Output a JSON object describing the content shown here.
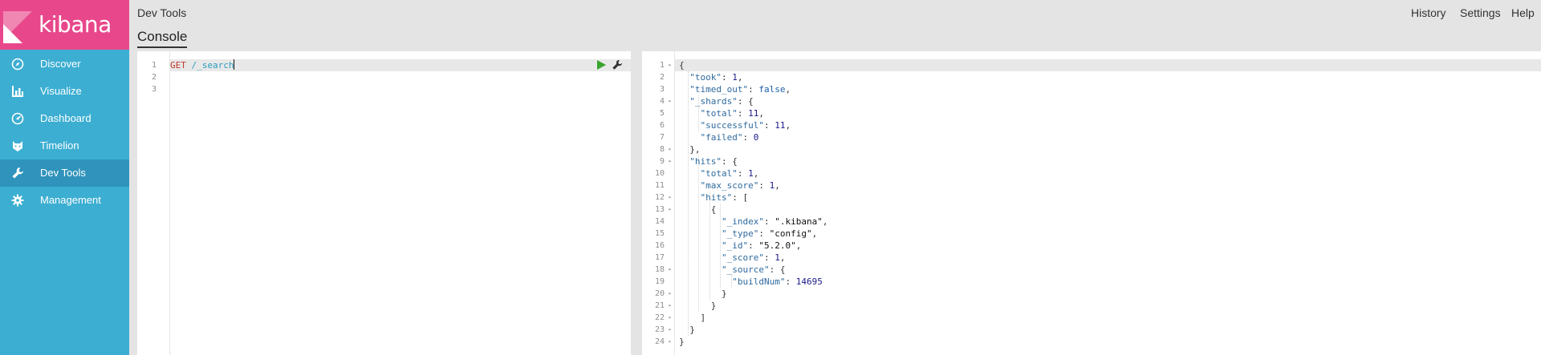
{
  "brand": {
    "name": "kibana",
    "colors": {
      "sidebar": "#3caed2",
      "logo": "#e8488b",
      "active": "#2f93bb"
    }
  },
  "sidebar": {
    "items": [
      {
        "label": "Discover",
        "icon": "compass-icon"
      },
      {
        "label": "Visualize",
        "icon": "bar-chart-icon"
      },
      {
        "label": "Dashboard",
        "icon": "dashboard-gauge-icon"
      },
      {
        "label": "Timelion",
        "icon": "timelion-cat-icon"
      },
      {
        "label": "Dev Tools",
        "icon": "wrench-icon",
        "active": true
      },
      {
        "label": "Management",
        "icon": "gear-icon"
      }
    ]
  },
  "header": {
    "title": "Dev Tools",
    "tab": "Console",
    "links": {
      "history": "History",
      "settings": "Settings",
      "help": "Help"
    }
  },
  "request": {
    "line_numbers": [
      "1",
      "2",
      "3"
    ],
    "method": "GET",
    "url": "/_search",
    "icons": [
      "play-icon",
      "wrench-icon"
    ]
  },
  "response": {
    "line_numbers": [
      "1",
      "2",
      "3",
      "4",
      "5",
      "6",
      "7",
      "8",
      "9",
      "10",
      "11",
      "12",
      "13",
      "14",
      "15",
      "16",
      "17",
      "18",
      "19",
      "20",
      "21",
      "22",
      "23",
      "24"
    ],
    "fold_lines": [
      "1",
      "4",
      "8",
      "9",
      "12",
      "13",
      "18",
      "20",
      "21",
      "22",
      "23",
      "24"
    ],
    "tokens": {
      "took": "\"took\"",
      "took_v": "1",
      "timed_out": "\"timed_out\"",
      "timed_out_v": "false",
      "shards": "\"_shards\"",
      "total": "\"total\"",
      "total_v": "11",
      "successful": "\"successful\"",
      "successful_v": "11",
      "failed": "\"failed\"",
      "failed_v": "0",
      "hits": "\"hits\"",
      "hits_total": "\"total\"",
      "hits_total_v": "1",
      "max_score": "\"max_score\"",
      "max_score_v": "1",
      "hits_arr": "\"hits\"",
      "index": "\"_index\"",
      "index_v": "\".kibana\"",
      "type": "\"_type\"",
      "type_v": "\"config\"",
      "id": "\"_id\"",
      "id_v": "\"5.2.0\"",
      "score": "\"_score\"",
      "score_v": "1",
      "source": "\"_source\"",
      "buildNum": "\"buildNum\"",
      "buildNum_v": "14695"
    }
  }
}
